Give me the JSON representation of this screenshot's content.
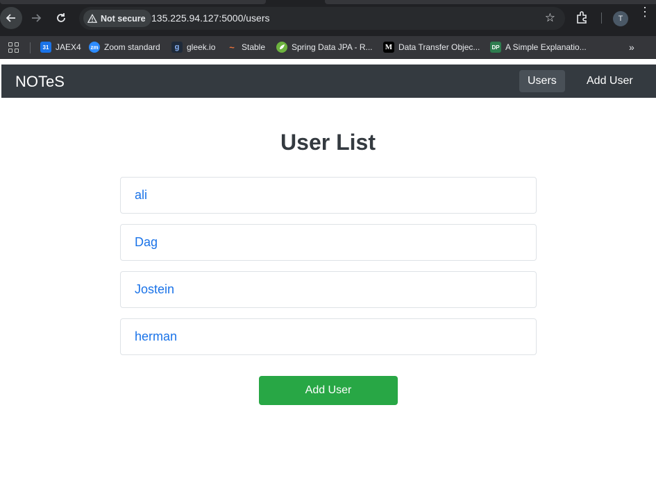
{
  "browser": {
    "security_label": "Not secure",
    "url": "135.225.94.127:5000/users",
    "profile_initial": "T",
    "bookmarks": [
      {
        "label": "JAEX4",
        "icon": "calendar-icon",
        "fav_text": "31",
        "fav_color": "#1a73e8"
      },
      {
        "label": "Zoom standard",
        "icon": "zoom-icon",
        "fav_text": "zm",
        "fav_color": "#2d8cff"
      },
      {
        "label": "gleek.io",
        "icon": "gleek-icon",
        "fav_text": "g",
        "fav_color": "#1e2a3a"
      },
      {
        "label": "Stable",
        "icon": "stable-icon",
        "fav_text": "~",
        "fav_color": "#35363a"
      },
      {
        "label": "Spring Data JPA - R...",
        "icon": "spring-icon",
        "fav_text": "",
        "fav_color": "#6db33f"
      },
      {
        "label": "Data Transfer Objec...",
        "icon": "medium-icon",
        "fav_text": "M",
        "fav_color": "#000000"
      },
      {
        "label": "A Simple Explanatio...",
        "icon": "dp-icon",
        "fav_text": "DP",
        "fav_color": "#2e7d4f"
      }
    ]
  },
  "app": {
    "brand": "NOTeS",
    "nav": {
      "users": "Users",
      "add_user": "Add User"
    },
    "title": "User List",
    "users": [
      "ali",
      "Dag",
      "Jostein",
      "herman"
    ],
    "add_user_button": "Add User",
    "colors": {
      "navbar": "#343a40",
      "link": "#1a73e8",
      "success": "#28a745"
    }
  }
}
